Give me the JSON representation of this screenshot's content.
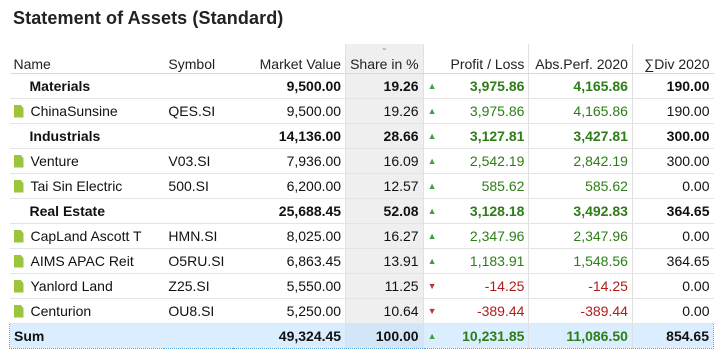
{
  "title": "Statement of Assets (Standard)",
  "columns": {
    "name": "Name",
    "symbol": "Symbol",
    "market_value": "Market Value",
    "share": "Share in %",
    "profit_loss": "Profit / Loss",
    "abs_perf": "Abs.Perf. 2020",
    "div": "∑Div 2020"
  },
  "sort_indicator": "⌄",
  "rows": [
    {
      "type": "group",
      "name": "Materials",
      "symbol": "",
      "market_value": "9,500.00",
      "share": "19.26",
      "profit_loss": "3,975.86",
      "pl_dir": "up",
      "abs_perf": "4,165.86",
      "div": "190.00"
    },
    {
      "type": "item",
      "name": "ChinaSunsine",
      "symbol": "QES.SI",
      "market_value": "9,500.00",
      "share": "19.26",
      "profit_loss": "3,975.86",
      "pl_dir": "up",
      "abs_perf": "4,165.86",
      "div": "190.00"
    },
    {
      "type": "group",
      "name": "Industrials",
      "symbol": "",
      "market_value": "14,136.00",
      "share": "28.66",
      "profit_loss": "3,127.81",
      "pl_dir": "up",
      "abs_perf": "3,427.81",
      "div": "300.00"
    },
    {
      "type": "item",
      "name": "Venture",
      "symbol": "V03.SI",
      "market_value": "7,936.00",
      "share": "16.09",
      "profit_loss": "2,542.19",
      "pl_dir": "up",
      "abs_perf": "2,842.19",
      "div": "300.00"
    },
    {
      "type": "item",
      "name": "Tai Sin Electric",
      "symbol": "500.SI",
      "market_value": "6,200.00",
      "share": "12.57",
      "profit_loss": "585.62",
      "pl_dir": "up",
      "abs_perf": "585.62",
      "div": "0.00"
    },
    {
      "type": "group",
      "name": "Real Estate",
      "symbol": "",
      "market_value": "25,688.45",
      "share": "52.08",
      "profit_loss": "3,128.18",
      "pl_dir": "up",
      "abs_perf": "3,492.83",
      "div": "364.65"
    },
    {
      "type": "item",
      "name": "CapLand Ascott T",
      "symbol": "HMN.SI",
      "market_value": "8,025.00",
      "share": "16.27",
      "profit_loss": "2,347.96",
      "pl_dir": "up",
      "abs_perf": "2,347.96",
      "div": "0.00"
    },
    {
      "type": "item",
      "name": "AIMS APAC Reit",
      "symbol": "O5RU.SI",
      "market_value": "6,863.45",
      "share": "13.91",
      "profit_loss": "1,183.91",
      "pl_dir": "up",
      "abs_perf": "1,548.56",
      "div": "364.65"
    },
    {
      "type": "item",
      "name": "Yanlord Land",
      "symbol": "Z25.SI",
      "market_value": "5,550.00",
      "share": "11.25",
      "profit_loss": "-14.25",
      "pl_dir": "down",
      "abs_perf": "-14.25",
      "div": "0.00"
    },
    {
      "type": "item",
      "name": "Centurion",
      "symbol": "OU8.SI",
      "market_value": "5,250.00",
      "share": "10.64",
      "profit_loss": "-389.44",
      "pl_dir": "down",
      "abs_perf": "-389.44",
      "div": "0.00"
    }
  ],
  "sum": {
    "name": "Sum",
    "symbol": "",
    "market_value": "49,324.45",
    "share": "100.00",
    "profit_loss": "10,231.85",
    "pl_dir": "up",
    "abs_perf": "11,086.50",
    "div": "854.65"
  },
  "icons": {
    "item": "document-icon",
    "up": "triangle-up-icon",
    "down": "triangle-down-icon"
  },
  "colors": {
    "positive": "#2e7d19",
    "negative": "#b31b1b",
    "doc_icon": "#9bc53d",
    "sum_bg": "#dbeeff"
  }
}
